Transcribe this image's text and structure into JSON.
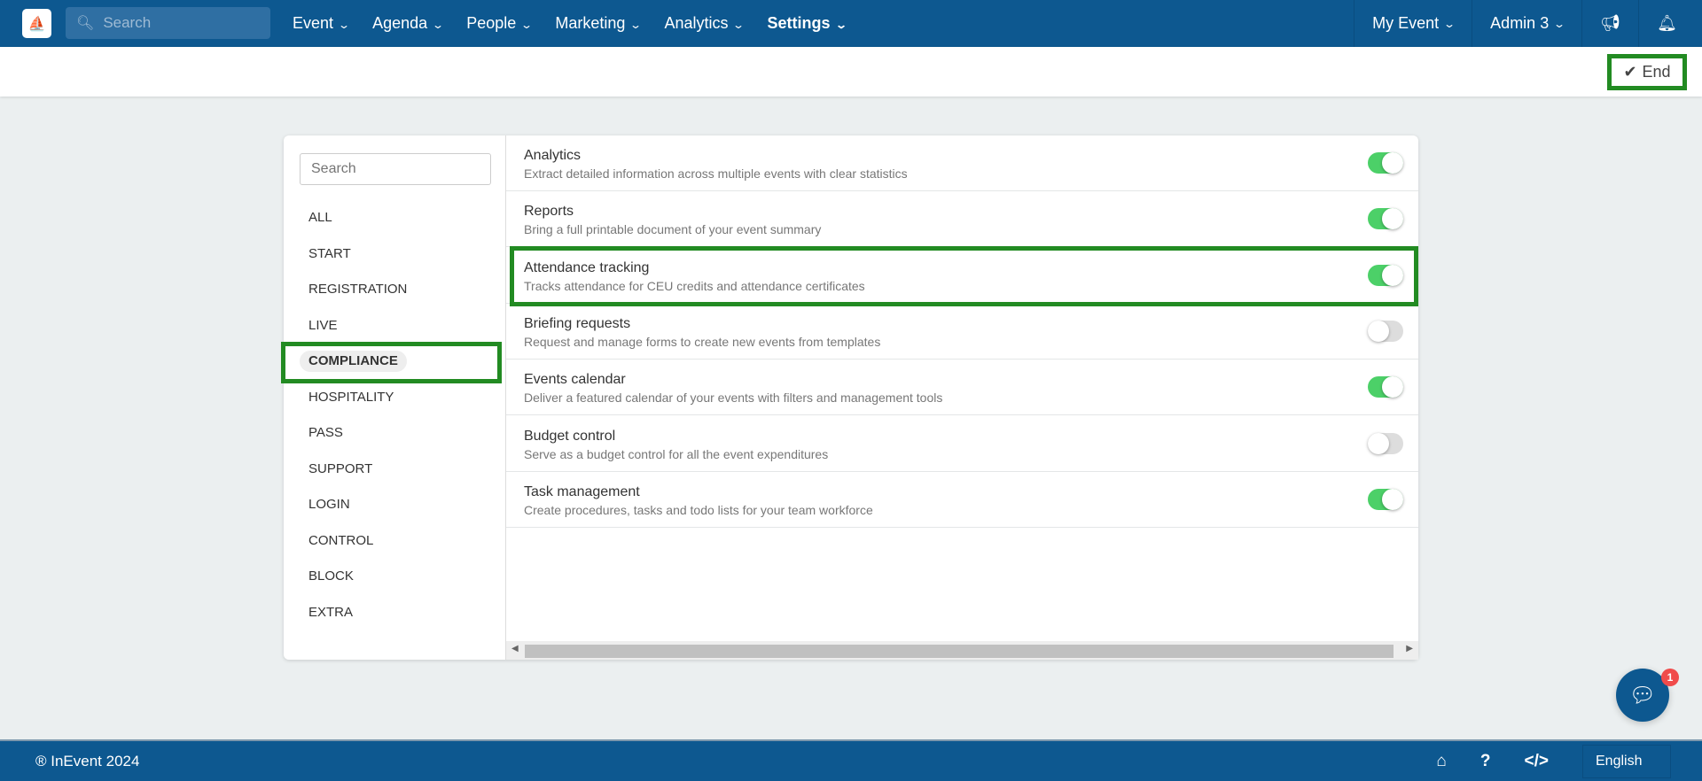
{
  "nav": {
    "search_placeholder": "Search",
    "menu": [
      {
        "label": "Event"
      },
      {
        "label": "Agenda"
      },
      {
        "label": "People"
      },
      {
        "label": "Marketing"
      },
      {
        "label": "Analytics"
      },
      {
        "label": "Settings",
        "active": true
      }
    ],
    "event": "My Event",
    "user": "Admin 3"
  },
  "toolbar": {
    "end_label": "End"
  },
  "sidebar": {
    "search_placeholder": "Search",
    "active": "COMPLIANCE",
    "categories": [
      "ALL",
      "START",
      "REGISTRATION",
      "LIVE",
      "COMPLIANCE",
      "HOSPITALITY",
      "PASS",
      "SUPPORT",
      "LOGIN",
      "CONTROL",
      "BLOCK",
      "EXTRA"
    ]
  },
  "tools": [
    {
      "title": "Analytics",
      "desc": "Extract detailed information across multiple events with clear statistics",
      "enabled": true
    },
    {
      "title": "Reports",
      "desc": "Bring a full printable document of your event summary",
      "enabled": true
    },
    {
      "title": "Attendance tracking",
      "desc": "Tracks attendance for CEU credits and attendance certificates",
      "enabled": true
    },
    {
      "title": "Briefing requests",
      "desc": "Request and manage forms to create new events from templates",
      "enabled": false
    },
    {
      "title": "Events calendar",
      "desc": "Deliver a featured calendar of your events with filters and management tools",
      "enabled": true
    },
    {
      "title": "Budget control",
      "desc": "Serve as a budget control for all the event expenditures",
      "enabled": false
    },
    {
      "title": "Task management",
      "desc": "Create procedures, tasks and todo lists for your team workforce",
      "enabled": true
    }
  ],
  "chat": {
    "badge": "1"
  },
  "footer": {
    "copyright": "® InEvent 2024",
    "language": "English"
  },
  "colors": {
    "primary": "#0d5890",
    "toggle_on": "#4cd068",
    "highlight": "#228b22"
  }
}
